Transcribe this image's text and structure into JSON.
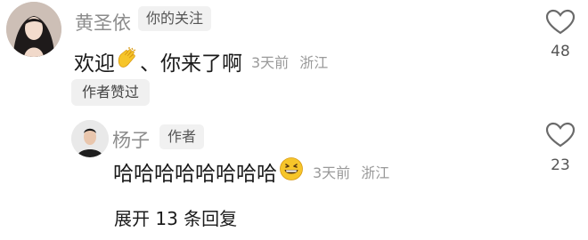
{
  "comment": {
    "username": "黄圣依",
    "follow_tag": "你的关注",
    "text_before": "欢迎",
    "text_after": "、你来了啊",
    "emoji": "clapping-hands-icon",
    "time": "3天前",
    "location": "浙江",
    "author_liked": "作者赞过",
    "like_count": "48"
  },
  "reply": {
    "username": "杨子",
    "author_tag": "作者",
    "text": "哈哈哈哈哈哈哈哈",
    "emoji": "grinning-face-icon",
    "time": "3天前",
    "location": "浙江",
    "like_count": "23"
  },
  "expand_replies": "展开 13 条回复",
  "colors": {
    "meta_gray": "#9a9a9a",
    "text": "#1a1a1a",
    "emoji_yellow": "#f6c52a"
  }
}
